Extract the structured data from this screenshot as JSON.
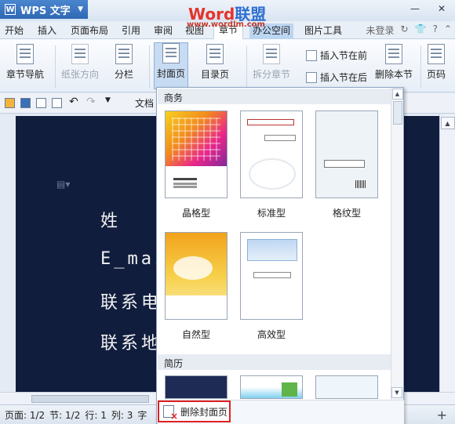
{
  "app": {
    "name": "WPS 文字",
    "watermark_text_a": "Word",
    "watermark_text_b": "联盟",
    "watermark_url": "www.wordlm.com",
    "win_minimize": "—",
    "win_close": "✕"
  },
  "menu": {
    "tabs": [
      "开始",
      "插入",
      "页面布局",
      "引用",
      "审阅",
      "视图",
      "章节",
      "办公空间",
      "图片工具"
    ],
    "active_tab": "章节",
    "login": "未登录"
  },
  "ribbon": {
    "chapter_nav": "章节导航",
    "paper_direction": "纸张方向",
    "columns": "分栏",
    "cover_page": "封面页",
    "toc_page": "目录页",
    "split_section": "拆分章节",
    "insert_section_before": "插入节在前",
    "insert_section_after": "插入节在后",
    "delete_section": "删除本节",
    "page_num": "页码"
  },
  "quickbar": {
    "doc_tab": "文档"
  },
  "document": {
    "lines": [
      "姓",
      "E_mai",
      "联系电",
      "联系地"
    ]
  },
  "cover_dropdown": {
    "section_business": "商务",
    "section_resume": "简历",
    "templates": [
      {
        "label": "晶格型"
      },
      {
        "label": "标准型"
      },
      {
        "label": "格纹型"
      },
      {
        "label": "自然型"
      },
      {
        "label": "高效型"
      }
    ],
    "delete_cover": "删除封面页"
  },
  "status": {
    "page": "页面: 1/2",
    "section": "节: 1/2",
    "row": "行: 1",
    "column": "列: 3",
    "chars": "字"
  }
}
